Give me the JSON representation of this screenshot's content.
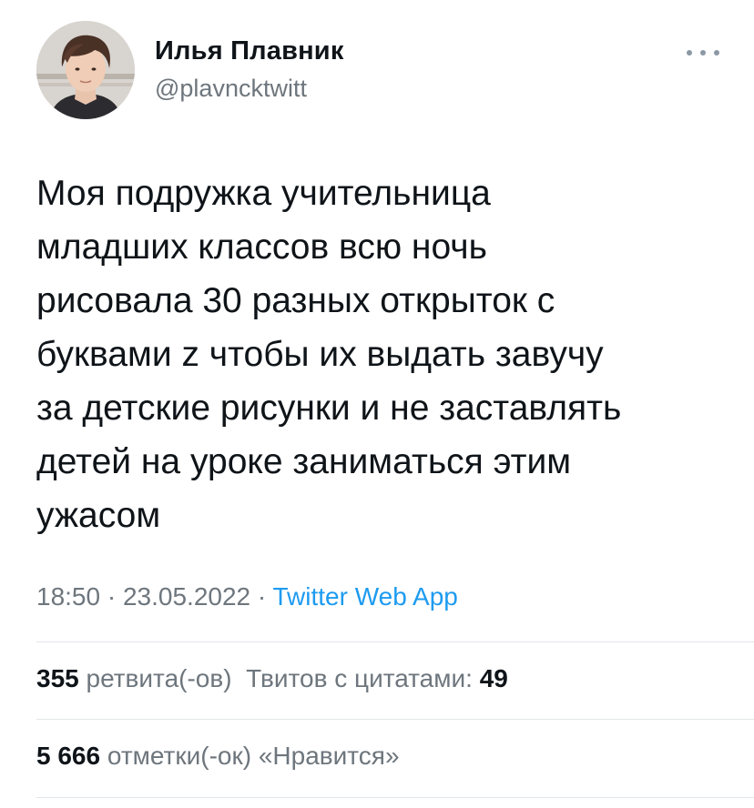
{
  "author": {
    "display_name": "Илья Плавник",
    "handle": "@plavncktwitt",
    "avatar_icon": "profile-photo"
  },
  "menu_icon": "more-horizontal-icon",
  "tweet": {
    "text": "Моя подружка учительница\nмладших классов всю ночь\nрисовала 30 разных открыток с\nбуквами z чтобы их выдать завучу\nза детские рисунки и не заставлять\nдетей на уроке заниматься этим\nужасом",
    "time": "18:50",
    "separator": " · ",
    "date": "23.05.2022",
    "source": "Twitter Web App"
  },
  "stats": {
    "retweets_count": "355",
    "retweets_label": "ретвита(-ов)",
    "quotes_label": "Твитов с цитатами:",
    "quotes_count": "49",
    "likes_count": "5 666",
    "likes_label": "отметки(-ок) «Нравится»"
  },
  "colors": {
    "text": "#0f1419",
    "secondary": "#6e767d",
    "link": "#1d9bf0",
    "divider": "#e1e6ea"
  }
}
